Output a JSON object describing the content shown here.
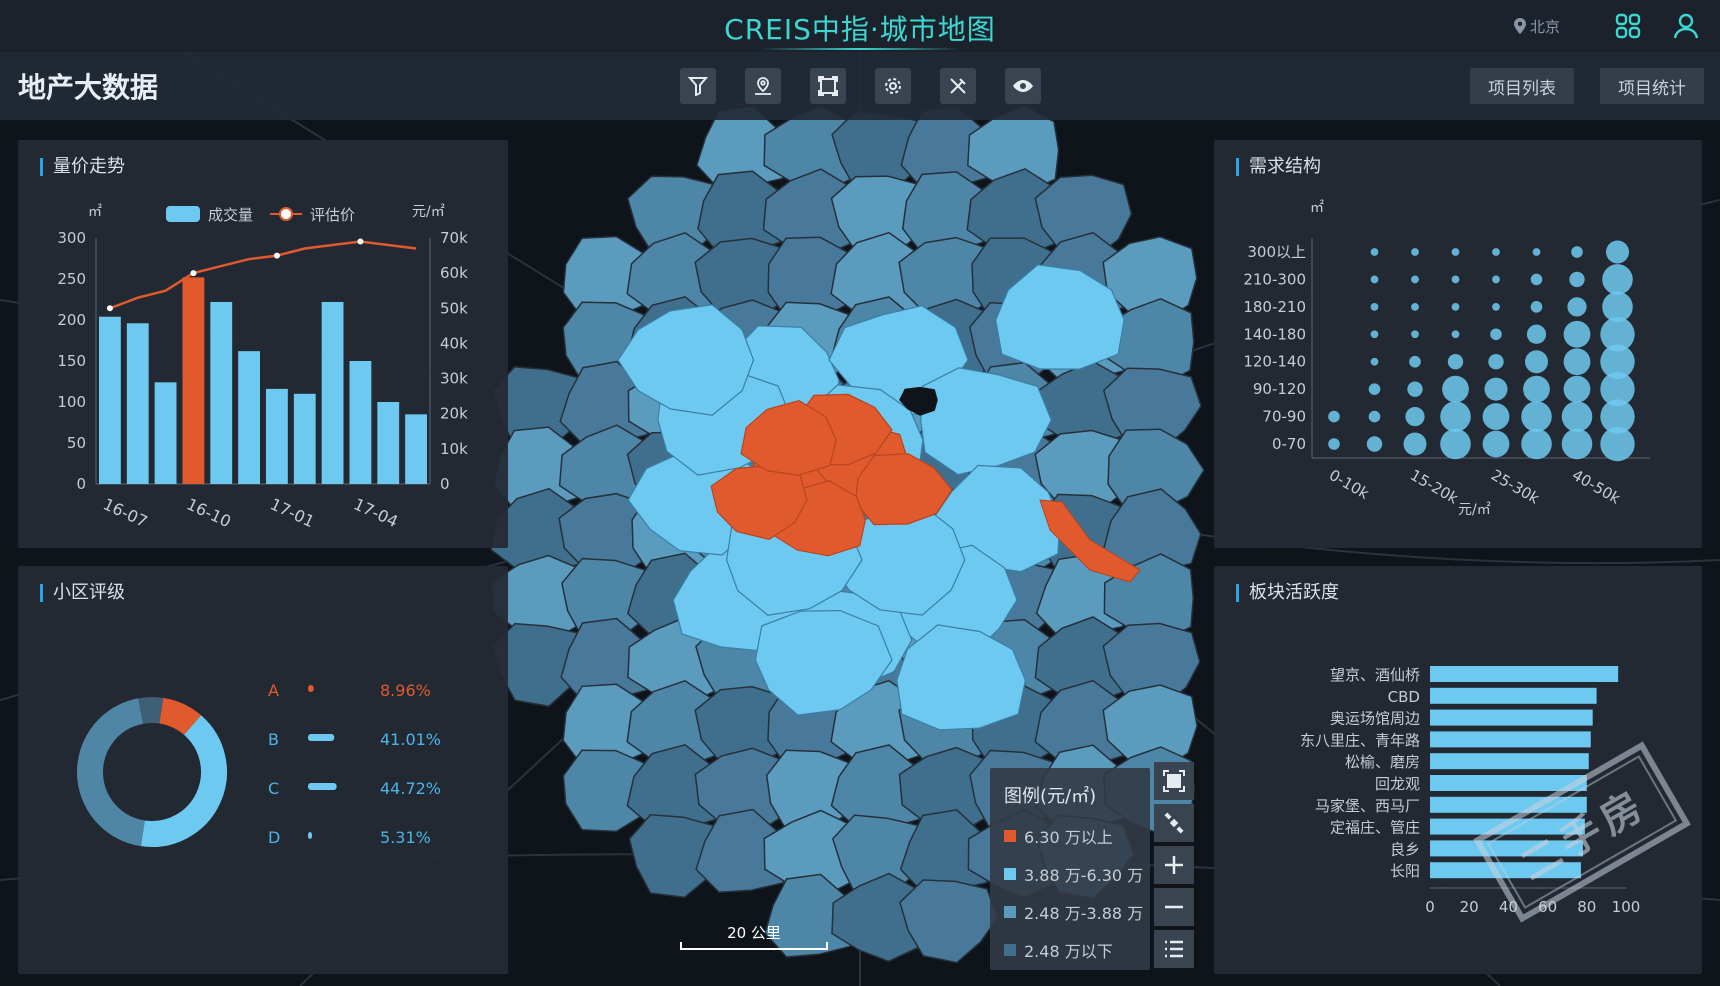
{
  "app": {
    "title": "CREIS中指·城市地图",
    "city": "北京",
    "page_title": "地产大数据"
  },
  "nav": {
    "list_label": "项目列表",
    "stats_label": "项目统计"
  },
  "toolbar": {
    "tools": [
      "filter-icon",
      "location-person-icon",
      "frame-icon",
      "gear-icon",
      "tools-icon",
      "eye-icon"
    ]
  },
  "colors": {
    "accent": "#3ed6d0",
    "orange": "#e15a2e",
    "light_blue": "#6ec9f0",
    "mid_blue": "#5b9bbd",
    "dark_blue": "#3f6f8c"
  },
  "panels": {
    "price_trend": {
      "title": "量价走势"
    },
    "rating": {
      "title": "小区评级"
    },
    "demand": {
      "title": "需求结构"
    },
    "activity": {
      "title": "板块活跃度"
    }
  },
  "map_legend": {
    "title": "图例(元/㎡)",
    "items": [
      {
        "label": "6.30 万以上",
        "color": "#e15a2e"
      },
      {
        "label": "3.88 万-6.30 万",
        "color": "#6ec9f0"
      },
      {
        "label": "2.48 万-3.88 万",
        "color": "#5b9bbd"
      },
      {
        "label": "2.48 万以下",
        "color": "#3f6f8c"
      }
    ]
  },
  "map_controls": [
    "fullscreen-icon",
    "satellite-icon",
    "zoom-in-icon",
    "zoom-out-icon",
    "list-icon"
  ],
  "scale": {
    "label": "20 公里"
  },
  "stamp": {
    "text": "二手房"
  },
  "chart_data": [
    {
      "type": "bar",
      "id": "price_trend",
      "left_unit": "㎡",
      "right_unit": "元/㎡",
      "legend": [
        "成交量",
        "评估价"
      ],
      "categories": [
        "16-07",
        "16-08",
        "16-09",
        "16-10",
        "16-11",
        "16-12",
        "17-01",
        "17-02",
        "17-03",
        "17-04",
        "17-05",
        "17-06"
      ],
      "x_ticks": [
        "16-07",
        "16-10",
        "17-01",
        "17-04"
      ],
      "series": [
        {
          "name": "成交量",
          "type": "bar",
          "values": [
            204,
            196,
            124,
            252,
            222,
            162,
            116,
            110,
            222,
            150,
            100,
            85
          ],
          "highlight_index": 3
        },
        {
          "name": "评估价",
          "type": "line",
          "values": [
            50000,
            53000,
            55000,
            60000,
            62000,
            64000,
            65000,
            67000,
            68000,
            69000,
            68000,
            67000
          ],
          "marker_indices": [
            0,
            3,
            6,
            9
          ]
        }
      ],
      "ylim_left": [
        0,
        300
      ],
      "y_ticks_left": [
        "0",
        "50",
        "100",
        "150",
        "200",
        "250",
        "300"
      ],
      "ylim_right": [
        0,
        70000
      ],
      "y_ticks_right": [
        "0",
        "10k",
        "20k",
        "30k",
        "40k",
        "50k",
        "60k",
        "70k"
      ]
    },
    {
      "type": "pie",
      "id": "rating",
      "categories": [
        "A",
        "B",
        "C",
        "D"
      ],
      "values": [
        8.96,
        41.01,
        44.72,
        5.31
      ],
      "labels": [
        "8.96%",
        "41.01%",
        "44.72%",
        "5.31%"
      ],
      "colors": [
        "#e15a2e",
        "#6ec9f0",
        "#4f86a6",
        "#3e5f75"
      ]
    },
    {
      "type": "scatter",
      "id": "demand",
      "y_unit": "㎡",
      "x_label": "元/㎡",
      "y_categories": [
        "0-70",
        "70-90",
        "90-120",
        "120-140",
        "140-180",
        "180-210",
        "210-300",
        "300以上"
      ],
      "x_ticks": [
        "0-10k",
        "15-20k",
        "25-30k",
        "40-50k"
      ],
      "x_count": 8,
      "sizes": [
        [
          2,
          3,
          5,
          7,
          6,
          7,
          7,
          8
        ],
        [
          2,
          2,
          4,
          7,
          6,
          7,
          7,
          8
        ],
        [
          0,
          2,
          3,
          6,
          5,
          6,
          6,
          8
        ],
        [
          0,
          1,
          2,
          3,
          3,
          5,
          6,
          8
        ],
        [
          0,
          1,
          1,
          1,
          2,
          4,
          6,
          8
        ],
        [
          0,
          1,
          1,
          1,
          1,
          2,
          4,
          7
        ],
        [
          0,
          1,
          1,
          1,
          1,
          2,
          3,
          7
        ],
        [
          0,
          1,
          1,
          1,
          1,
          1,
          2,
          5
        ]
      ]
    },
    {
      "type": "bar",
      "id": "activity",
      "orientation": "horizontal",
      "categories": [
        "望京、酒仙桥",
        "CBD",
        "奥运场馆周边",
        "东八里庄、青年路",
        "松榆、磨房",
        "回龙观",
        "马家堡、西马厂",
        "定福庄、管庄",
        "良乡",
        "长阳"
      ],
      "values": [
        96,
        85,
        83,
        82,
        81,
        80,
        80,
        79,
        78,
        77
      ],
      "xlim": [
        0,
        100
      ],
      "x_ticks": [
        "0",
        "20",
        "40",
        "60",
        "80",
        "100"
      ]
    }
  ]
}
